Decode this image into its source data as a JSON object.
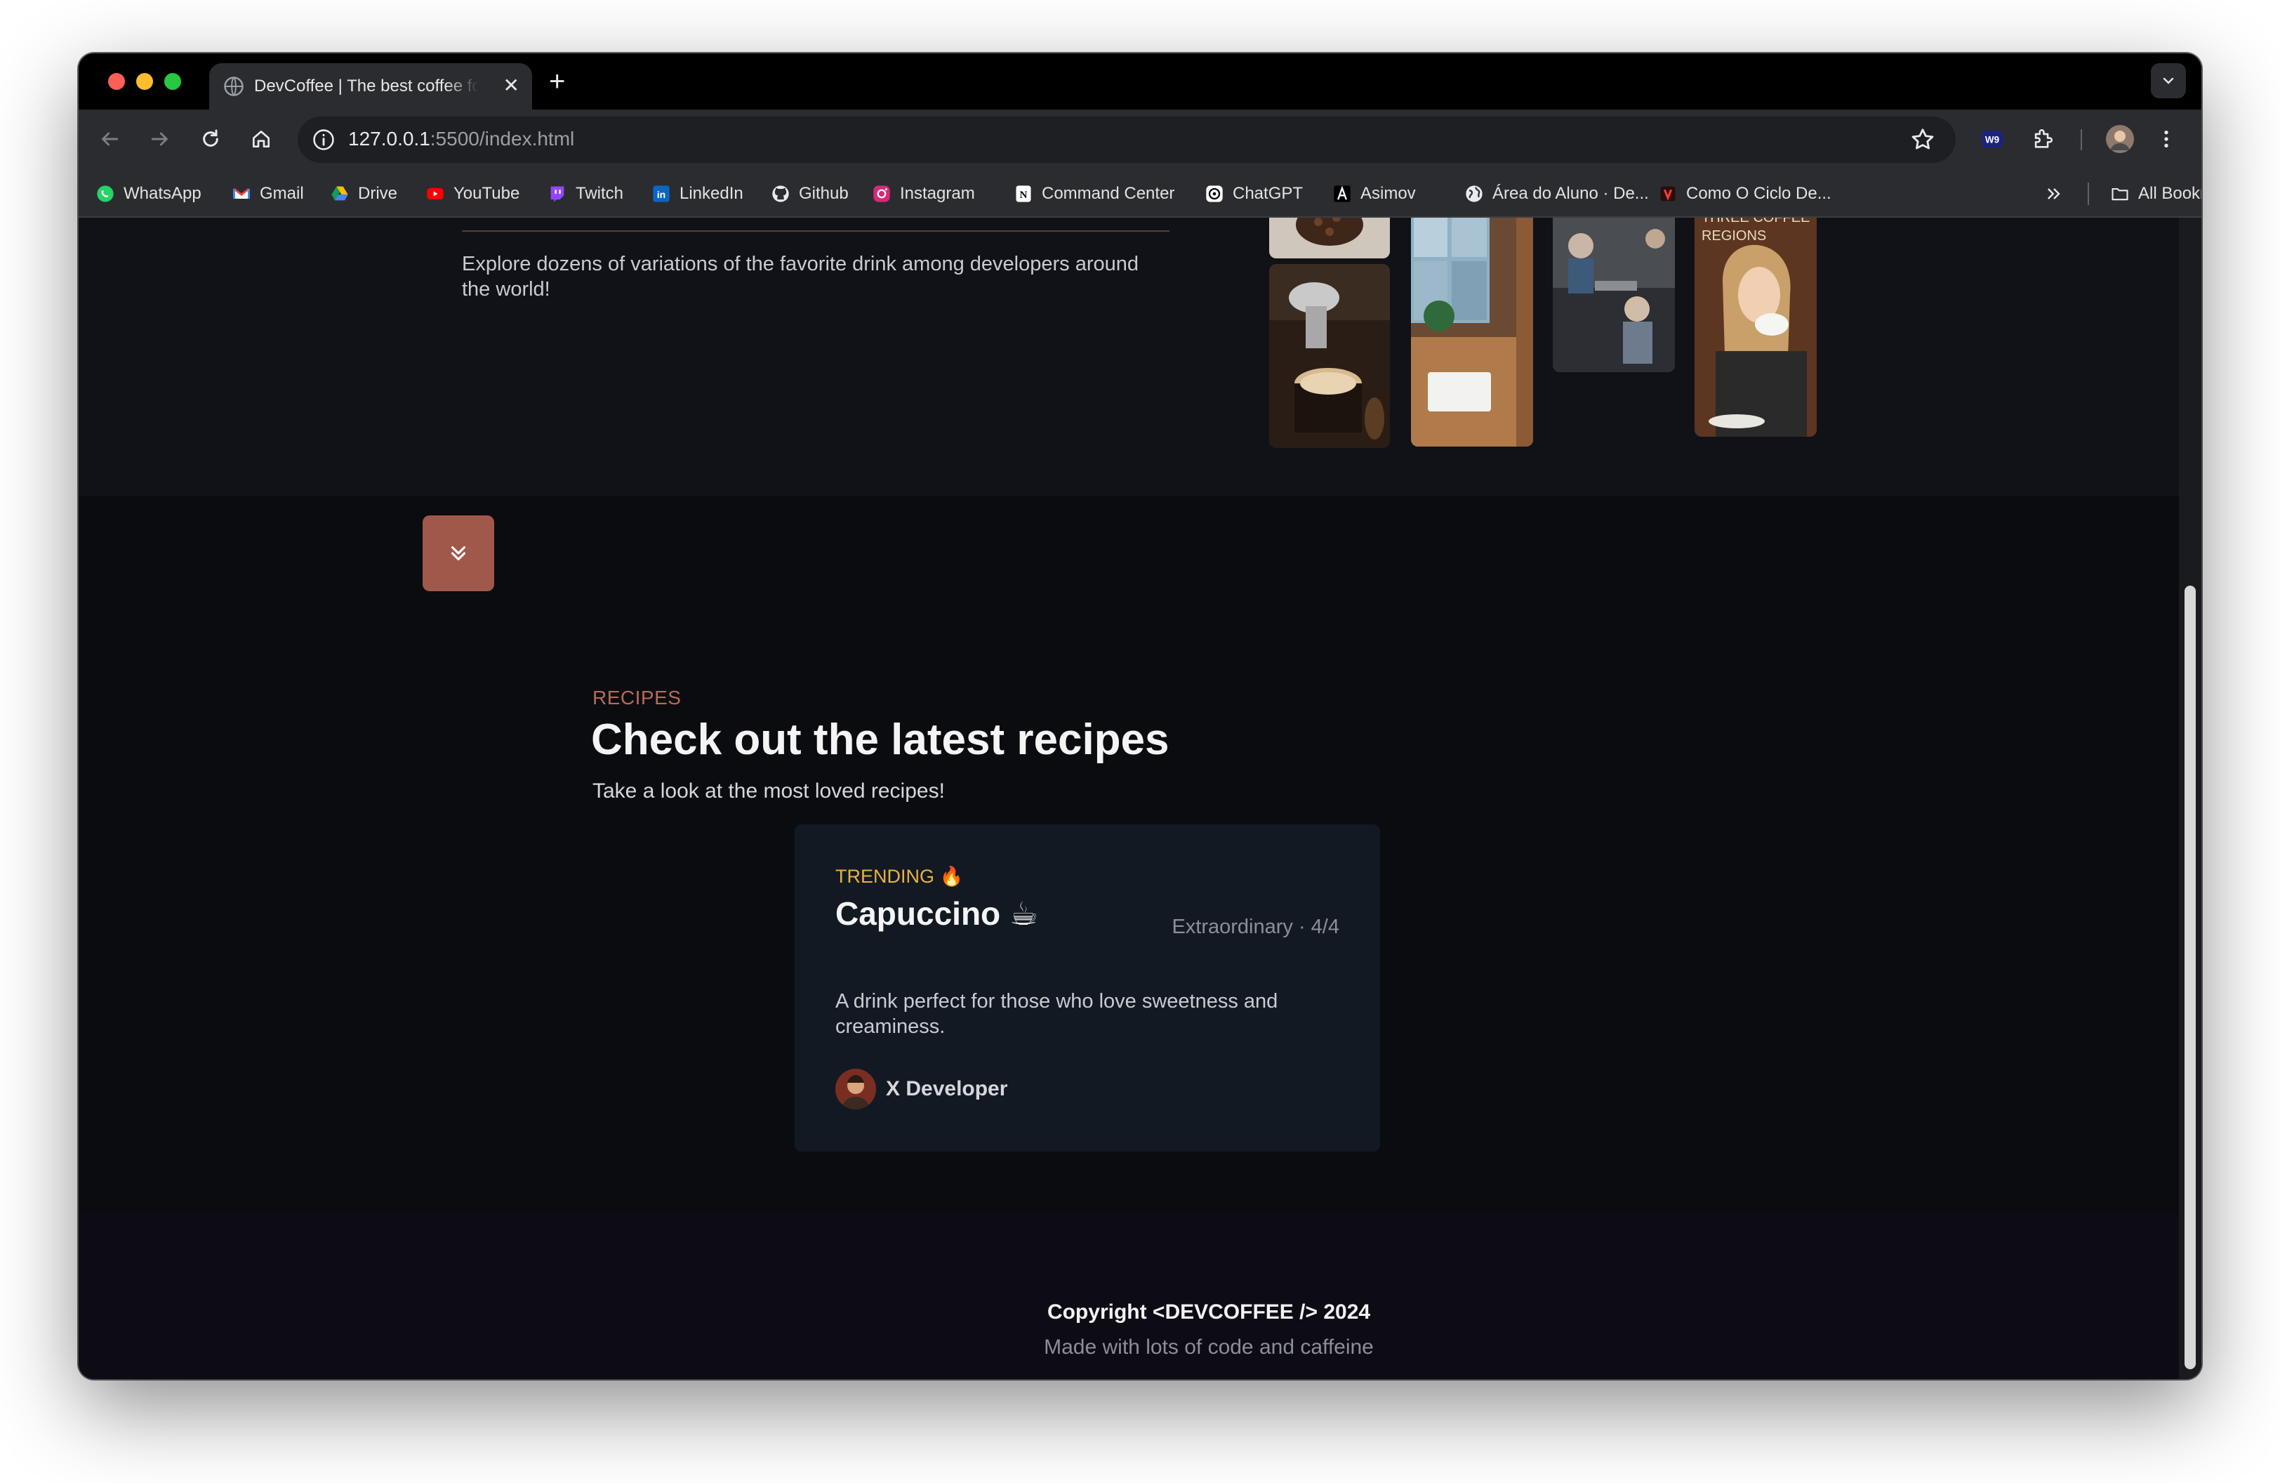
{
  "browser": {
    "tab_title": "DevCoffee | The best coffee for developers",
    "new_tab_label": "+",
    "url_host": "127.0.0.1",
    "url_path": ":5500/index.html",
    "bookmarks": [
      {
        "label": "WhatsApp",
        "icon": "whatsapp-icon"
      },
      {
        "label": "Gmail",
        "icon": "gmail-icon"
      },
      {
        "label": "Drive",
        "icon": "drive-icon"
      },
      {
        "label": "YouTube",
        "icon": "youtube-icon"
      },
      {
        "label": "Twitch",
        "icon": "twitch-icon"
      },
      {
        "label": "LinkedIn",
        "icon": "linkedin-icon"
      },
      {
        "label": "Github",
        "icon": "github-icon"
      },
      {
        "label": "Instagram",
        "icon": "instagram-icon"
      },
      {
        "label": "Command Center",
        "icon": "notion-icon"
      },
      {
        "label": "ChatGPT",
        "icon": "chatgpt-icon"
      },
      {
        "label": "Asimov",
        "icon": "asimov-icon"
      },
      {
        "label": "Área do Aluno · De...",
        "icon": "globe-icon"
      },
      {
        "label": "Como O Ciclo De...",
        "icon": "site-icon"
      }
    ],
    "all_bookmarks_label": "All Bookmarks"
  },
  "hero": {
    "description": "Explore dozens of variations of the favorite drink among developers around the world!",
    "photo_text": "THREE COFFEE REGIONS"
  },
  "recipes": {
    "eyebrow": "RECIPES",
    "title": "Check out the latest recipes",
    "subtitle": "Take a look at the most loved recipes!",
    "card": {
      "badge": "TRENDING 🔥",
      "name": "Capuccino ☕",
      "rating": "Extraordinary · 4/4",
      "description": "A drink perfect for those who love sweetness and creaminess.",
      "author": "X Developer"
    }
  },
  "footer": {
    "copyright": "Copyright <DEVCOFFEE /> 2024",
    "tagline": "Made with lots of code and caffeine"
  },
  "colors": {
    "accent": "#a0584b",
    "eyebrow": "#b86a59",
    "trending": "#e7b342",
    "page_bg": "#0b0c10"
  }
}
